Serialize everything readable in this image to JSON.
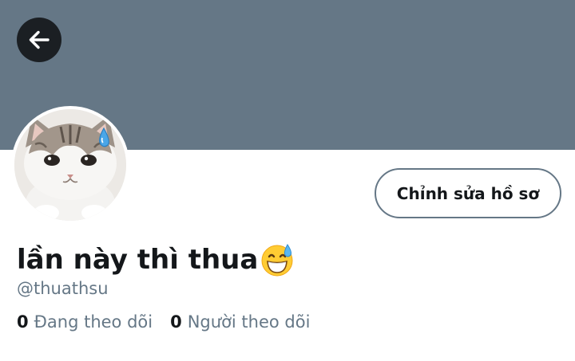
{
  "header": {
    "back_icon": "arrow-left-icon",
    "banner_color": "#657786"
  },
  "profile": {
    "avatar_description": "cat-avatar",
    "display_name": "lần này thì thua",
    "name_emoji": "grinning-face-with-sweat-icon",
    "handle": "@thuathsu",
    "edit_button_label": "Chỉnh sửa hồ sơ"
  },
  "stats": {
    "following": {
      "count": "0",
      "label": "Đang theo dõi"
    },
    "followers": {
      "count": "0",
      "label": "Người theo dõi"
    }
  }
}
